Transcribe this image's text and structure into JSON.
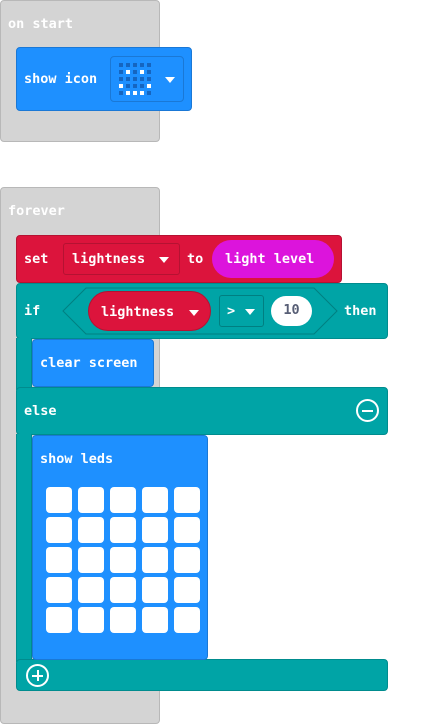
{
  "on_start": {
    "label": "on start",
    "show_icon": {
      "label": "show icon",
      "icon_pattern": [
        [
          0,
          0,
          0,
          0,
          0
        ],
        [
          0,
          1,
          0,
          1,
          0
        ],
        [
          0,
          0,
          0,
          0,
          0
        ],
        [
          1,
          0,
          0,
          0,
          1
        ],
        [
          0,
          1,
          1,
          1,
          0
        ]
      ]
    }
  },
  "forever": {
    "label": "forever",
    "set_block": {
      "set_label": "set",
      "variable": "lightness",
      "to_label": "to",
      "value": "light level"
    },
    "if_block": {
      "if_label": "if",
      "left": "lightness",
      "operator": ">",
      "right": "10",
      "then_label": "then",
      "then_body": "clear screen",
      "else_label": "else"
    },
    "show_leds": {
      "label": "show leds",
      "grid": [
        [
          0,
          0,
          0,
          0,
          0
        ],
        [
          0,
          0,
          0,
          0,
          0
        ],
        [
          0,
          0,
          0,
          0,
          0
        ],
        [
          0,
          0,
          0,
          0,
          0
        ],
        [
          0,
          0,
          0,
          0,
          0
        ]
      ]
    }
  },
  "colors": {
    "event": "#d4d4d4",
    "basic": "#1e90ff",
    "variables": "#dc143c",
    "logic": "#00a4a6",
    "input": "#dc14dc"
  }
}
